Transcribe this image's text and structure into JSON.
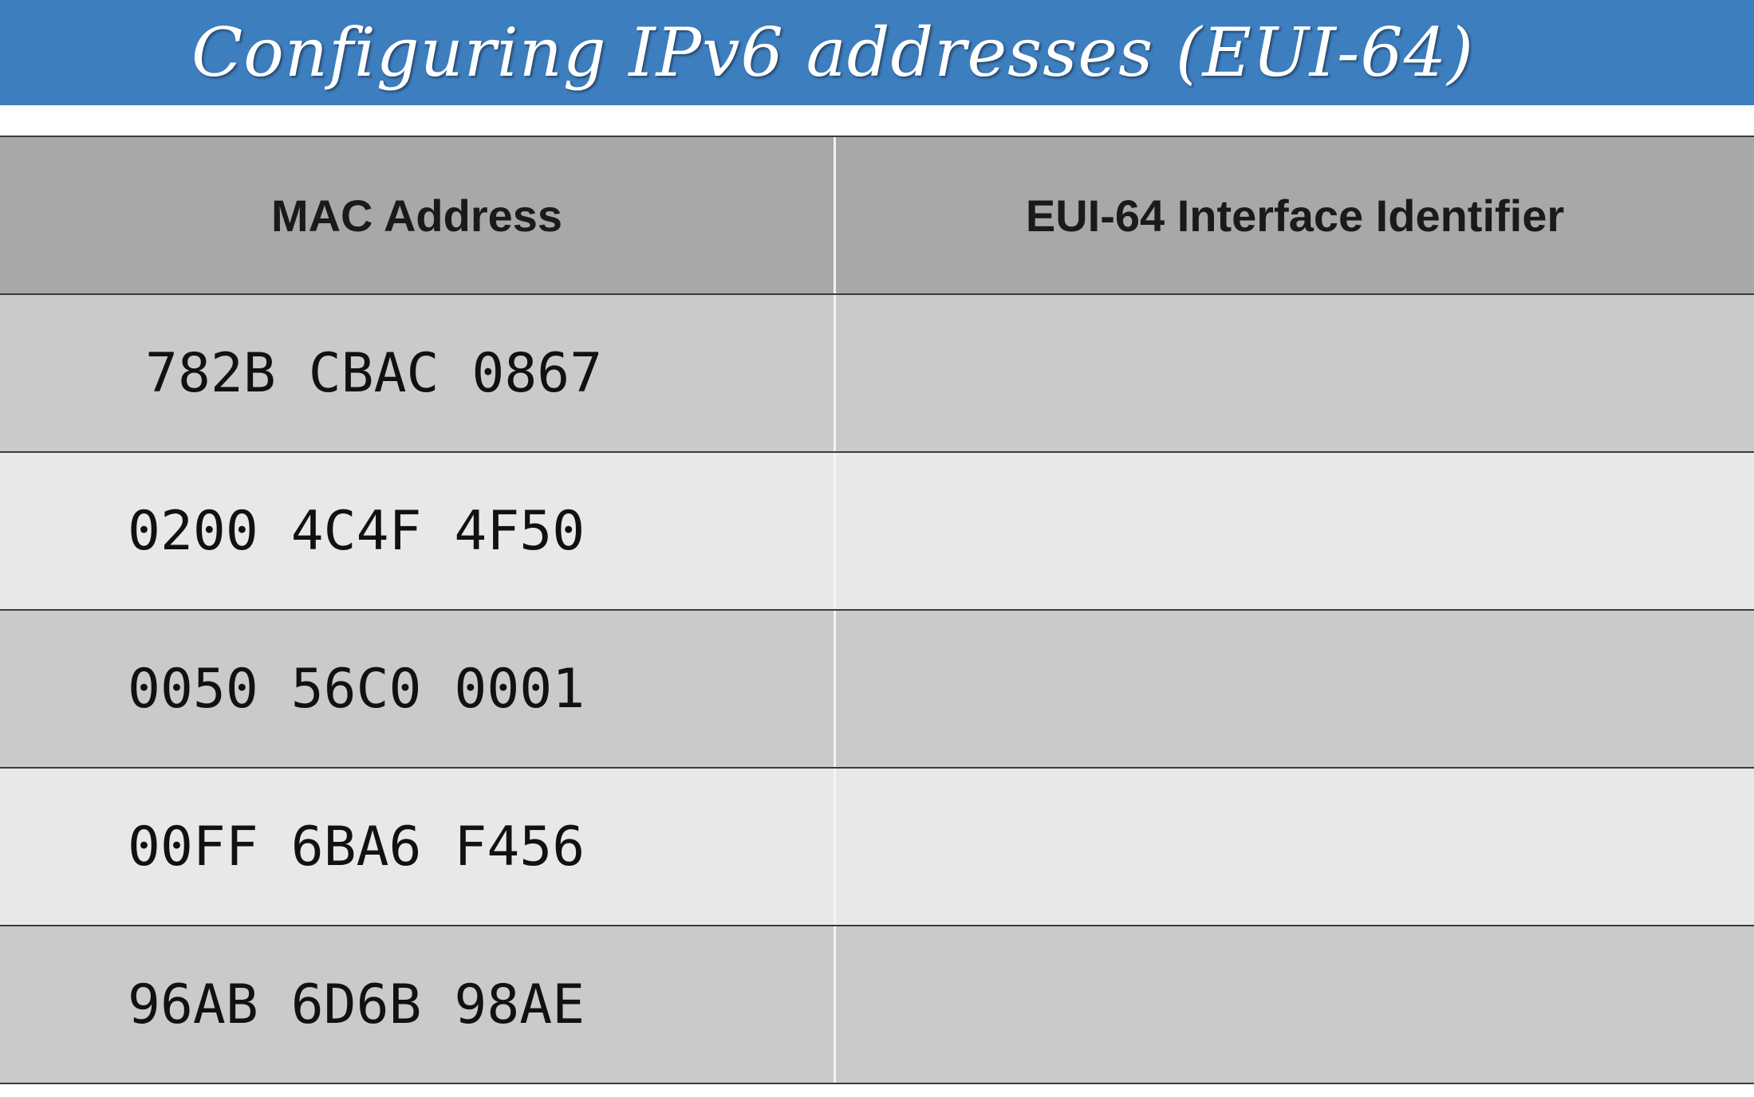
{
  "title": "Configuring IPv6 addresses (EUI-64)",
  "table": {
    "headers": [
      "MAC Address",
      "EUI-64 Interface Identifier"
    ],
    "rows": [
      {
        "mac": "782B CBAC 0867",
        "eui64": ""
      },
      {
        "mac": "0200 4C4F 4F50",
        "eui64": ""
      },
      {
        "mac": "0050 56C0 0001",
        "eui64": ""
      },
      {
        "mac": "00FF 6BA6 F456",
        "eui64": ""
      },
      {
        "mac": "96AB 6D6B 98AE",
        "eui64": ""
      }
    ]
  },
  "colors": {
    "title_bar": "#3d7ebf",
    "header_row": "#a8a8a8",
    "dark_row": "#cacaca",
    "light_row": "#e8e8e8"
  }
}
